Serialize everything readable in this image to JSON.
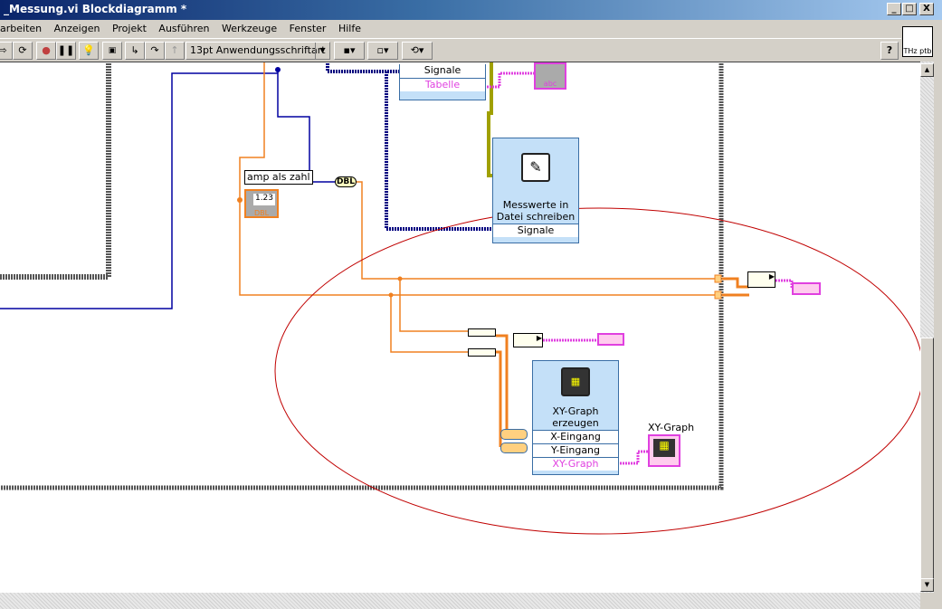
{
  "window": {
    "title": "_Messung.vi Blockdiagramm *",
    "controls": [
      "_",
      "□",
      "X"
    ]
  },
  "menu": [
    "arbeiten",
    "Anzeigen",
    "Projekt",
    "Ausführen",
    "Werkzeuge",
    "Fenster",
    "Hilfe"
  ],
  "toolbar": {
    "font": "13pt Anwendungsschriftart",
    "help": "?",
    "vi_icon_label": "THz ptb"
  },
  "diagram": {
    "node_write": {
      "title": "Messwerte in Datei schreiben",
      "terminal": "Signale"
    },
    "node_table": {
      "terminals": [
        "Signale",
        "Tabelle"
      ]
    },
    "amp_label": "amp als zahl",
    "amp_value": "1.23",
    "amp_type": "DBL",
    "dbl_convert": "DBL",
    "node_xy": {
      "title": "XY-Graph erzeugen",
      "terminals": [
        "X-Eingang",
        "Y-Eingang",
        "XY-Graph"
      ]
    },
    "xy_graph_label": "XY-Graph",
    "string_ind_type": "abc",
    "colors": {
      "orange": "#f08020",
      "blue": "#0000a0",
      "pink": "#e040e0",
      "annotation": "#c00000"
    }
  }
}
